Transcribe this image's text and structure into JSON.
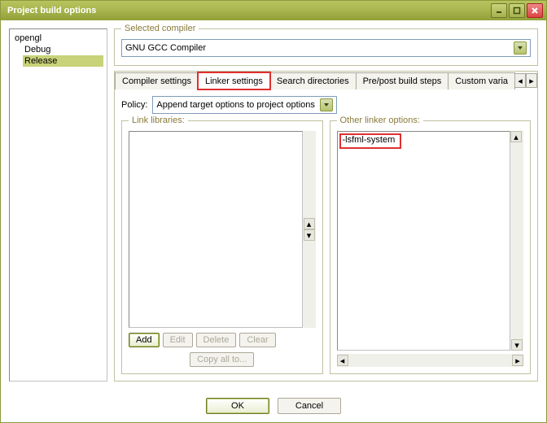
{
  "title": "Project build options",
  "tree": {
    "root": "opengl",
    "child1": "Debug",
    "child2": "Release"
  },
  "compiler_group": "Selected compiler",
  "compiler_selected": "GNU GCC Compiler",
  "tabs": {
    "compiler": "Compiler settings",
    "linker": "Linker settings",
    "search": "Search directories",
    "prepost": "Pre/post build steps",
    "custom": "Custom varia"
  },
  "policy_label": "Policy:",
  "policy_value": "Append target options to project options",
  "link_libs_title": "Link libraries:",
  "other_opts_title": "Other linker options:",
  "other_opts_text": "-lsfml-system",
  "buttons": {
    "add": "Add",
    "edit": "Edit",
    "delete": "Delete",
    "clear": "Clear",
    "copy": "Copy all to...",
    "ok": "OK",
    "cancel": "Cancel"
  }
}
